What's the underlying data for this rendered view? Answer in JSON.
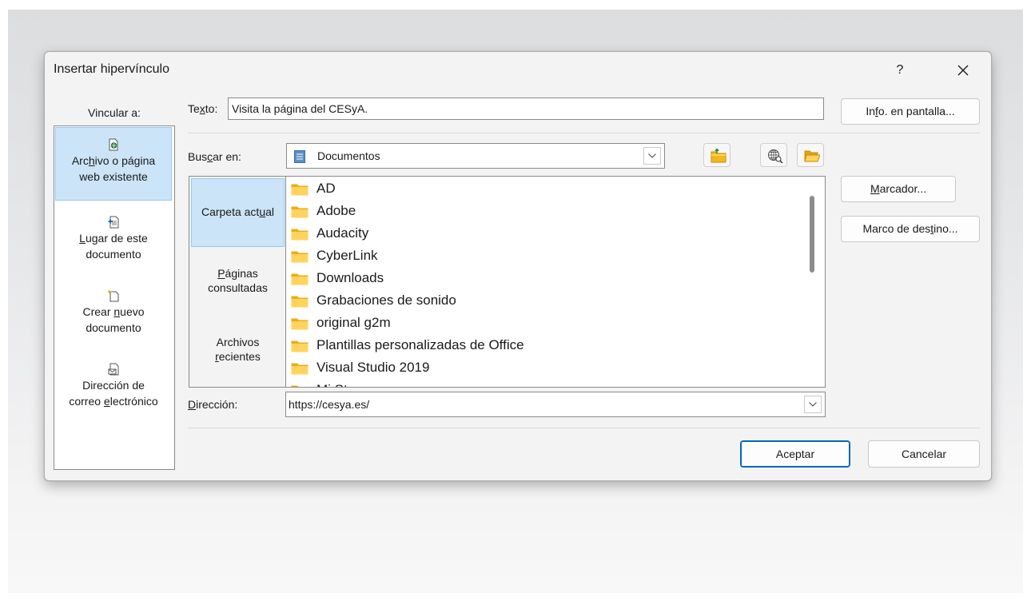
{
  "dialog": {
    "title": "Insertar hipervínculo",
    "help_label": "?"
  },
  "link_to": {
    "label": "Vincular a:",
    "items": [
      {
        "line1_pre": "Arc",
        "line1_u": "h",
        "line1_post": "ivo o página",
        "line2": "web existente",
        "icon": "web-page-icon",
        "selected": true
      },
      {
        "line1_pre": "",
        "line1_u": "L",
        "line1_post": "ugar de este",
        "line2": "documento",
        "icon": "place-in-document-icon",
        "selected": false
      },
      {
        "line1_pre": "Crear ",
        "line1_u": "n",
        "line1_post": "uevo",
        "line2": "documento",
        "icon": "new-document-icon",
        "selected": false
      },
      {
        "line1_pre": "Dirección de",
        "line1_u": "",
        "line1_post": "",
        "line2_pre": "correo ",
        "line2_u": "e",
        "line2_post": "lectrónico",
        "icon": "email-address-icon",
        "selected": false
      }
    ]
  },
  "text_field": {
    "label_pre": "Te",
    "label_u": "x",
    "label_post": "to:",
    "value": "Visita la página del CESyA."
  },
  "screen_tip_button": {
    "pre": "In",
    "u": "f",
    "post": "o. en pantalla..."
  },
  "look_in": {
    "label_pre": "Bus",
    "label_u": "c",
    "label_post": "ar en:",
    "value": "Documentos"
  },
  "side_tabs": [
    {
      "pre": "Carpeta act",
      "u": "u",
      "post": "al",
      "line2": "",
      "selected": true
    },
    {
      "pre": "",
      "u": "P",
      "post": "áginas",
      "line2": "consultadas",
      "selected": false
    },
    {
      "pre": "Archivos",
      "u": "",
      "post": "",
      "line2_u": "r",
      "line2_post": "ecientes",
      "selected": false
    }
  ],
  "files": [
    "AD",
    "Adobe",
    "Audacity",
    "CyberLink",
    "Downloads",
    "Grabaciones de sonido",
    "original g2m",
    "Plantillas personalizadas de Office",
    "Visual Studio 2019",
    "Mi St..."
  ],
  "address": {
    "label_pre": "",
    "label_u": "D",
    "label_post": "irección:",
    "value": "https://cesya.es/"
  },
  "right_buttons": {
    "bookmark": {
      "pre": "",
      "u": "M",
      "post": "arcador..."
    },
    "target_frame": {
      "pre": "Marco de des",
      "u": "t",
      "post": "ino..."
    }
  },
  "footer": {
    "ok": "Aceptar",
    "cancel": "Cancelar"
  },
  "colors": {
    "selection": "#cce4f7",
    "selection_border": "#99c9ef",
    "primary_border": "#0067c0",
    "folder_yellow": "#ffd35c"
  }
}
